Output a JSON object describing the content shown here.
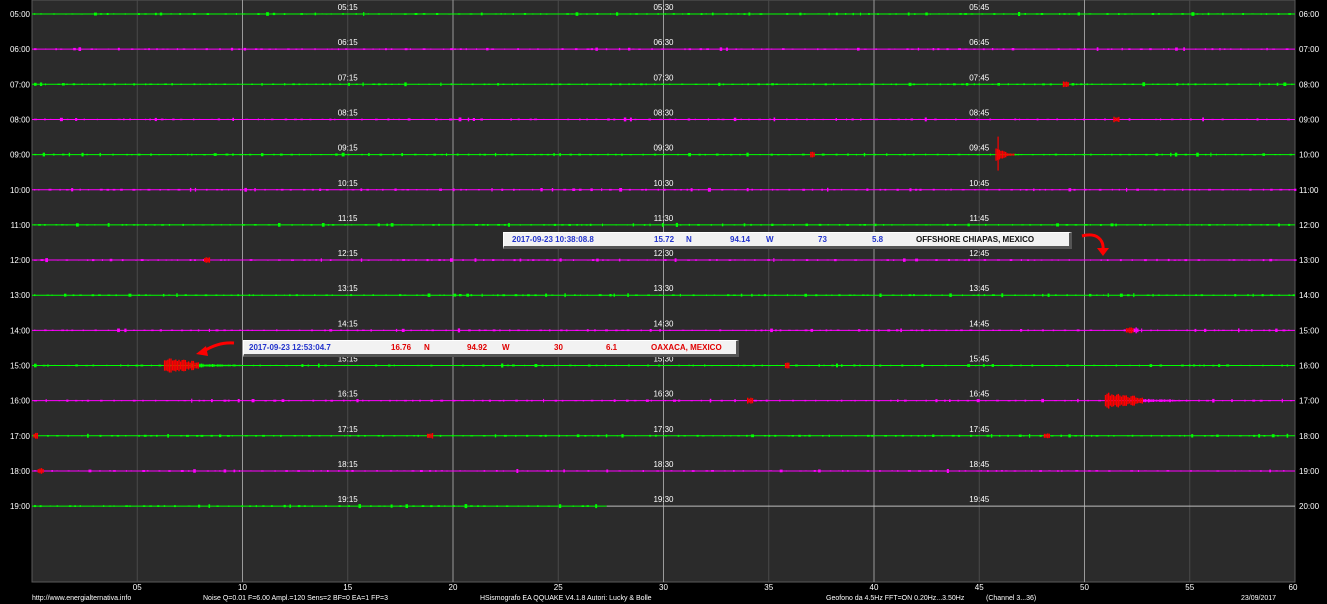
{
  "chart_data": {
    "type": "line",
    "title": "",
    "xlabel": "",
    "ylabel": "",
    "x_ticks": [
      "05",
      "10",
      "15",
      "20",
      "25",
      "30",
      "35",
      "40",
      "45",
      "50",
      "55",
      "60"
    ],
    "xlim": [
      0,
      60
    ],
    "rows": [
      {
        "left": "05:00",
        "right": "06:00",
        "color": "#00ff00",
        "marks": [
          "05:15",
          "05:30",
          "05:45"
        ]
      },
      {
        "left": "06:00",
        "right": "07:00",
        "color": "#ff00ff",
        "marks": [
          "06:15",
          "06:30",
          "06:45"
        ]
      },
      {
        "left": "07:00",
        "right": "08:00",
        "color": "#00ff00",
        "marks": [
          "07:15",
          "07:30",
          "07:45"
        ]
      },
      {
        "left": "08:00",
        "right": "09:00",
        "color": "#ff00ff",
        "marks": [
          "08:15",
          "08:30",
          "08:45"
        ]
      },
      {
        "left": "09:00",
        "right": "10:00",
        "color": "#00ff00",
        "marks": [
          "09:15",
          "09:30",
          "09:45"
        ]
      },
      {
        "left": "10:00",
        "right": "11:00",
        "color": "#ff00ff",
        "marks": [
          "10:15",
          "10:30",
          "10:45"
        ]
      },
      {
        "left": "11:00",
        "right": "12:00",
        "color": "#00ff00",
        "marks": [
          "11:15",
          "11:30",
          "11:45"
        ]
      },
      {
        "left": "12:00",
        "right": "13:00",
        "color": "#ff00ff",
        "marks": [
          "12:15",
          "12:30",
          "12:45"
        ]
      },
      {
        "left": "13:00",
        "right": "14:00",
        "color": "#00ff00",
        "marks": [
          "13:15",
          "13:30",
          "13:45"
        ]
      },
      {
        "left": "14:00",
        "right": "15:00",
        "color": "#ff00ff",
        "marks": [
          "14:15",
          "14:30",
          "14:45"
        ]
      },
      {
        "left": "15:00",
        "right": "16:00",
        "color": "#00ff00",
        "marks": [
          "15:15",
          "15:30",
          "15:45"
        ]
      },
      {
        "left": "16:00",
        "right": "17:00",
        "color": "#ff00ff",
        "marks": [
          "16:15",
          "16:30",
          "16:45"
        ]
      },
      {
        "left": "17:00",
        "right": "18:00",
        "color": "#00ff00",
        "marks": [
          "17:15",
          "17:30",
          "17:45"
        ]
      },
      {
        "left": "18:00",
        "right": "19:00",
        "color": "#ff00ff",
        "marks": [
          "18:15",
          "18:30",
          "18:45"
        ]
      },
      {
        "left": "19:00",
        "right": "20:00",
        "color": "#00ff00",
        "marks": [
          "19:15",
          "19:30",
          "19:45"
        ],
        "end_minute": 27.3
      }
    ],
    "events": [
      {
        "row": 11,
        "minute_start": 51,
        "minute_end": 56,
        "color": "#ff0000",
        "tail_color": "#ff00ff"
      },
      {
        "row": 10,
        "minute_start": 6.3,
        "minute_end": 11,
        "color": "#ff0000",
        "tail_color": "#00ff00"
      },
      {
        "row": 4,
        "minute_start": 45.8,
        "minute_end": 47.2,
        "color": "#ff0000",
        "tail_color": "#00ff00"
      },
      {
        "row": 2,
        "minute_start": 49.0,
        "minute_end": 49.3,
        "color": "#ff0000",
        "tail_color": "#ff0000"
      },
      {
        "row": 3,
        "minute_start": 51.4,
        "minute_end": 51.7,
        "color": "#ff0000",
        "tail_color": "#ff0000"
      },
      {
        "row": 4,
        "minute_start": 37.0,
        "minute_end": 37.2,
        "color": "#ff0000",
        "tail_color": "#ff0000"
      },
      {
        "row": 7,
        "minute_start": 8.2,
        "minute_end": 8.5,
        "color": "#ff0000",
        "tail_color": "#ff0000"
      },
      {
        "row": 9,
        "minute_start": 52.0,
        "minute_end": 52.6,
        "color": "#ff0000",
        "tail_color": "#ff00ff"
      },
      {
        "row": 10,
        "minute_start": 35.8,
        "minute_end": 36.0,
        "color": "#ff0000",
        "tail_color": "#ff0000"
      },
      {
        "row": 11,
        "minute_start": 34.0,
        "minute_end": 34.3,
        "color": "#ff0000",
        "tail_color": "#ff0000"
      },
      {
        "row": 12,
        "minute_start": 0.1,
        "minute_end": 0.3,
        "color": "#ff0000",
        "tail_color": "#ff0000"
      },
      {
        "row": 12,
        "minute_start": 18.8,
        "minute_end": 19.1,
        "color": "#ff0000",
        "tail_color": "#ff0000"
      },
      {
        "row": 12,
        "minute_start": 48.1,
        "minute_end": 48.4,
        "color": "#ff0000",
        "tail_color": "#ff0000"
      },
      {
        "row": 13,
        "minute_start": 0.3,
        "minute_end": 0.6,
        "color": "#ff0000",
        "tail_color": "#ff0000"
      }
    ]
  },
  "quake_chiapas": {
    "datetime": "2017-09-23   10:38:08.8",
    "lat": "15.72",
    "lat_dir": "N",
    "lon": "94.14",
    "lon_dir": "W",
    "depth": "73",
    "mag": "5.8",
    "region": "OFFSHORE CHIAPAS, MEXICO"
  },
  "quake_oaxaca": {
    "datetime": "2017-09-23   12:53:04.7",
    "lat": "16.76",
    "lat_dir": "N",
    "lon": "94.92",
    "lon_dir": "W",
    "depth": "30",
    "mag": "6.1",
    "region": "OAXACA, MEXICO"
  },
  "footer": {
    "url": "http://www.energialternativa.info",
    "settings": "Noise Q=0.01 F=6.00 Ampl.=120 Sens=2 BF=0 EA=1 FP=3",
    "program": "HSismografo EA QQUAKE   V4.1.8  Autori: Lucky & Bolle",
    "geophone": "Geofono da 4.5Hz FFT=ON 0.20Hz...3.50Hz",
    "channel": "(Channel 3...36)",
    "date": "23/09/2017"
  },
  "colors": {
    "green": "#00ff00",
    "magenta": "#ff00ff",
    "event": "#ff0000"
  }
}
